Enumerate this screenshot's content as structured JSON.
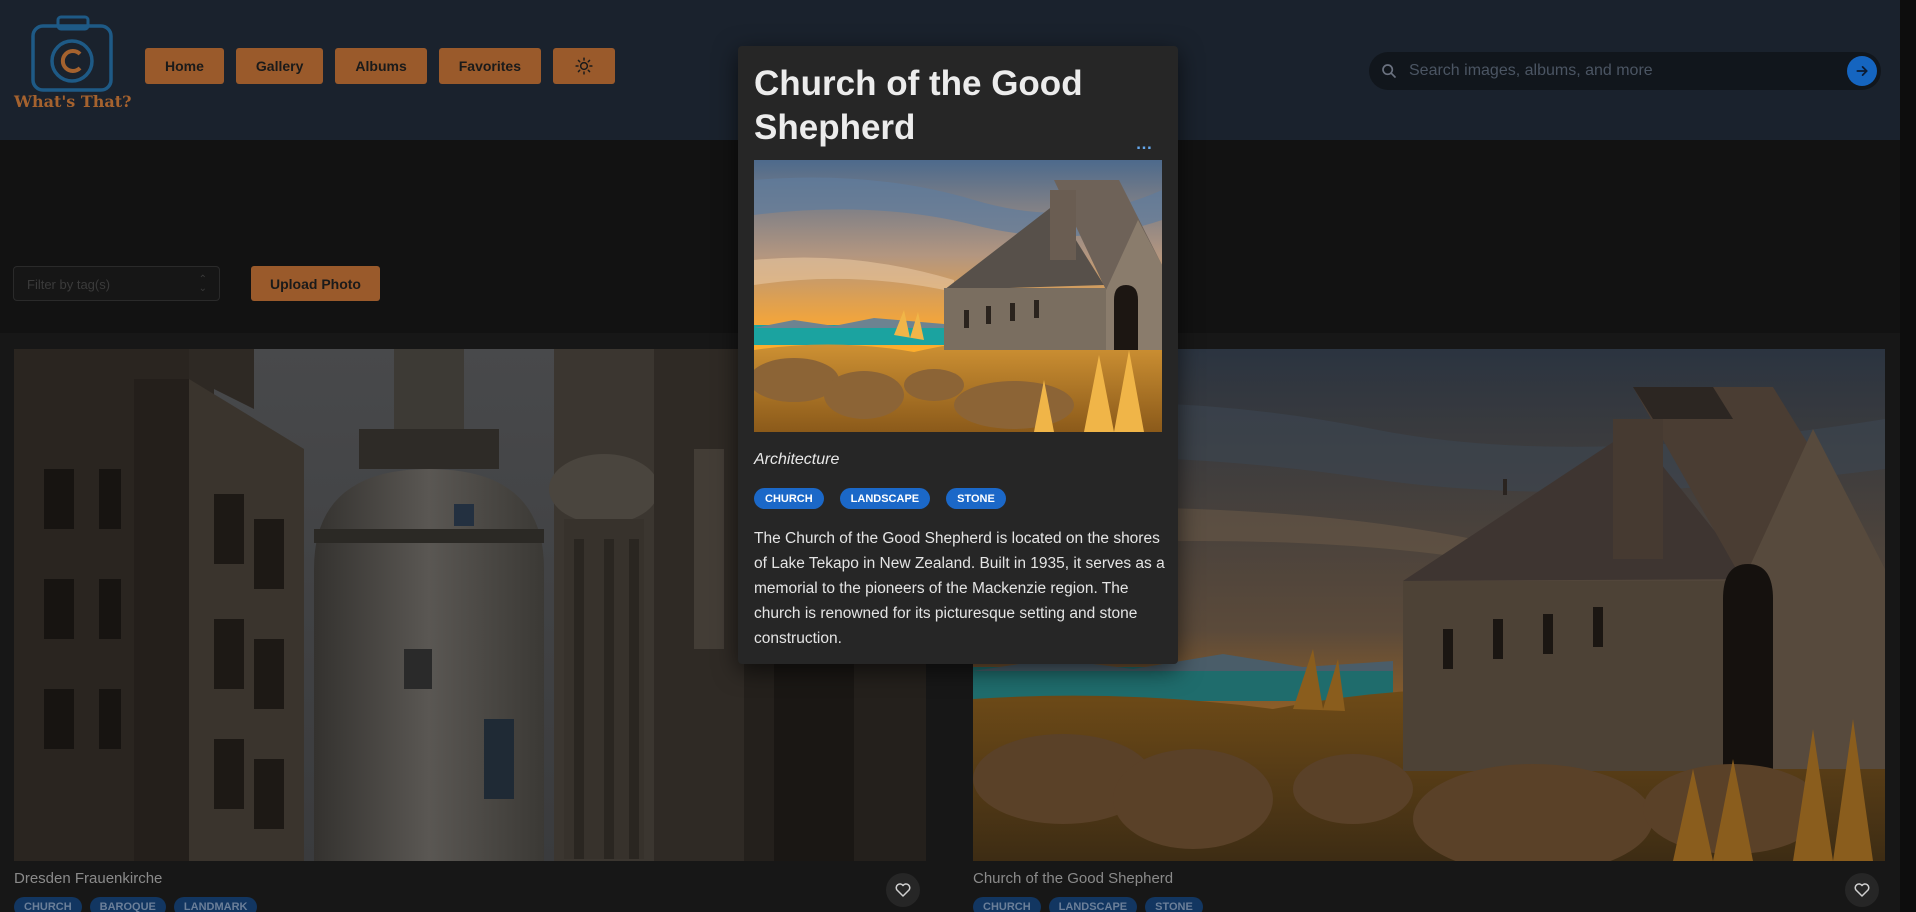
{
  "app": {
    "logo_text": "What's That?"
  },
  "nav": {
    "items": [
      {
        "label": "Home"
      },
      {
        "label": "Gallery"
      },
      {
        "label": "Albums"
      },
      {
        "label": "Favorites"
      }
    ],
    "theme_icon": "sun-icon"
  },
  "search": {
    "placeholder": "Search images, albums, and more",
    "icon": "search-icon",
    "submit_icon": "arrow-right-icon"
  },
  "toolbar": {
    "filter_placeholder": "Filter by tag(s)",
    "upload_label": "Upload Photo"
  },
  "gallery": [
    {
      "title": "Dresden Frauenkirche",
      "tags": [
        "CHURCH",
        "BAROQUE",
        "LANDMARK"
      ]
    },
    {
      "title": "Church of the Good Shepherd",
      "tags": [
        "CHURCH",
        "LANDSCAPE",
        "STONE"
      ]
    }
  ],
  "modal": {
    "title": "Church of the Good Shepherd",
    "more_label": "…",
    "category": "Architecture",
    "tags": [
      "CHURCH",
      "LANDSCAPE",
      "STONE"
    ],
    "description": "The Church of the Good Shepherd is located on the shores of Lake Tekapo in New Zealand. Built in 1935, it serves as a memorial to the pioneers of the Mackenzie region. The church is renowned for its picturesque setting and stone construction."
  },
  "colors": {
    "accent": "#9a5a2b",
    "tag_blue": "#1b68c8",
    "header_bg": "#1a222d",
    "page_bg": "#121212"
  }
}
